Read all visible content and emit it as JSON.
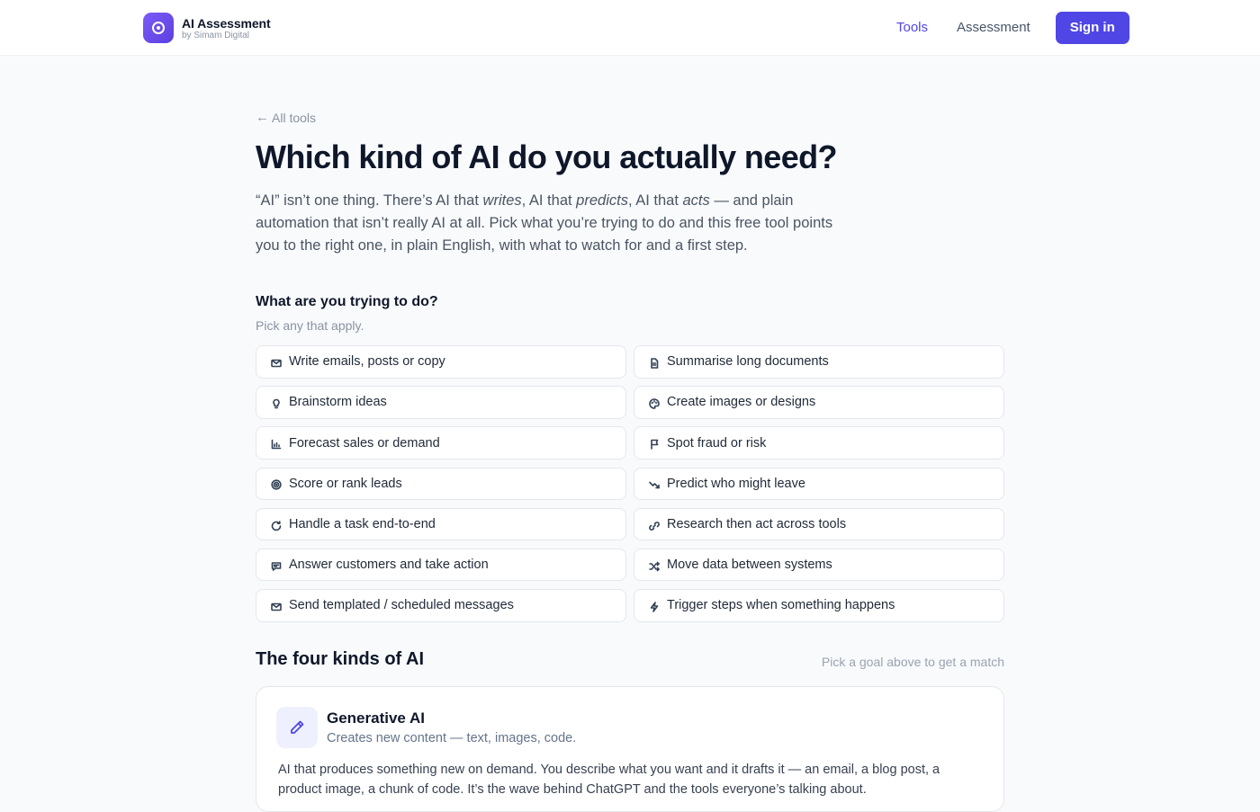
{
  "header": {
    "brand_title": "AI Assessment",
    "brand_sub": "by Simam Digital",
    "nav": [
      {
        "label": "Tools",
        "active": true
      },
      {
        "label": "Assessment",
        "active": false
      }
    ],
    "signin_label": "Sign in"
  },
  "main": {
    "back_label": "All tools",
    "title": "Which kind of AI do you actually need?",
    "intro": {
      "p1": "“AI” isn’t one thing. There’s AI that ",
      "e1": "writes",
      "p2": ", AI that ",
      "e2": "predicts",
      "p3": ", AI that ",
      "e3": "acts",
      "p4": " — and plain automation that isn’t really AI at all. Pick what you’re trying to do and this free tool points you to the right one, in plain English, with what to watch for and a first step."
    },
    "question": "What are you trying to do?",
    "question_hint": "Pick any that apply.",
    "goals": [
      {
        "label": "Write emails, posts or copy",
        "icon": "mail-icon"
      },
      {
        "label": "Summarise long documents",
        "icon": "document-icon"
      },
      {
        "label": "Brainstorm ideas",
        "icon": "lightbulb-icon"
      },
      {
        "label": "Create images or designs",
        "icon": "palette-icon"
      },
      {
        "label": "Forecast sales or demand",
        "icon": "bar-chart-icon"
      },
      {
        "label": "Spot fraud or risk",
        "icon": "flag-icon"
      },
      {
        "label": "Score or rank leads",
        "icon": "target-icon"
      },
      {
        "label": "Predict who might leave",
        "icon": "trending-down-icon"
      },
      {
        "label": "Handle a task end-to-end",
        "icon": "refresh-icon"
      },
      {
        "label": "Research then act across tools",
        "icon": "link-icon"
      },
      {
        "label": "Answer customers and take action",
        "icon": "chat-icon"
      },
      {
        "label": "Move data between systems",
        "icon": "shuffle-icon"
      },
      {
        "label": "Send templated / scheduled messages",
        "icon": "mail-icon"
      },
      {
        "label": "Trigger steps when something happens",
        "icon": "lightning-icon"
      }
    ],
    "kinds_title": "The four kinds of AI",
    "kinds_hint": "Pick a goal above to get a match",
    "card": {
      "icon": "pencil-icon",
      "title": "Generative AI",
      "subtitle": "Creates new content — text, images, code.",
      "body": "AI that produces something new on demand. You describe what you want and it drafts it — an email, a blog post, a product image, a chunk of code. It’s the wave behind ChatGPT and the tools everyone’s talking about."
    }
  }
}
